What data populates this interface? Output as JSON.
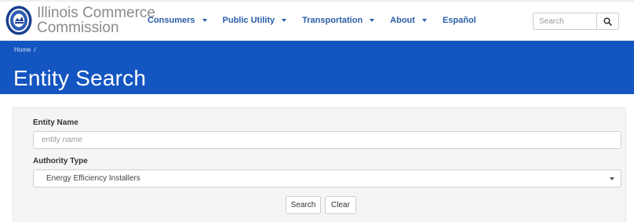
{
  "header": {
    "brand_line1": "Illinois Commerce",
    "brand_line2": "Commission",
    "logo": "icc-seal-logo",
    "nav": [
      {
        "label": "Consumers",
        "has_dropdown": true
      },
      {
        "label": "Public Utility",
        "has_dropdown": true
      },
      {
        "label": "Transportation",
        "has_dropdown": true
      },
      {
        "label": "About",
        "has_dropdown": true
      },
      {
        "label": "Español",
        "has_dropdown": false
      }
    ],
    "search": {
      "placeholder": "Search",
      "value": "",
      "icon": "search-icon"
    }
  },
  "banner": {
    "breadcrumb": {
      "home": "Home",
      "separator": "/"
    },
    "title": "Entity Search",
    "color": "#1355c1"
  },
  "form": {
    "entity_name": {
      "label": "Entity Name",
      "placeholder": "entity name",
      "value": ""
    },
    "authority_type": {
      "label": "Authority Type",
      "selected": "Energy Efficiency Installers"
    },
    "buttons": {
      "search": "Search",
      "clear": "Clear"
    }
  }
}
